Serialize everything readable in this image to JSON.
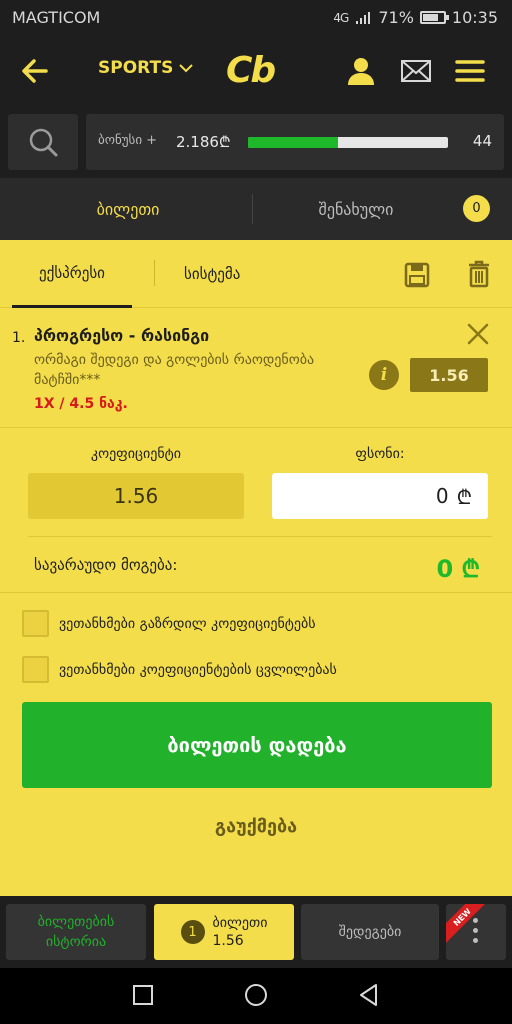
{
  "status_bar": {
    "carrier": "MAGTICOM",
    "network": "4G",
    "battery": "71%",
    "time": "10:35"
  },
  "header": {
    "back_icon": "back-arrow-icon",
    "sports_label": "SPORTS",
    "logo": "Cb",
    "icons": [
      "user-icon",
      "mail-icon",
      "menu-icon"
    ]
  },
  "bonus": {
    "label": "ბონუსი +",
    "value": "2.186₾",
    "progress_percent": 45,
    "count": "44"
  },
  "ticket_tabs": {
    "ticket": "ბილეთი",
    "saved": "შენახული",
    "saved_count": "0"
  },
  "sub_tabs": {
    "express": "ექსპრესი",
    "system": "სისტემა"
  },
  "bet": {
    "number": "1.",
    "title": "პროგრესო - რასინგი",
    "description": "ორმაგი შედეგი და გოლების რაოდენობა მატჩში***",
    "pick": "1X / 4.5 ნაკ.",
    "odd": "1.56"
  },
  "coefficient": {
    "label": "კოეფიციენტი",
    "value": "1.56"
  },
  "stake": {
    "label": "ფსონი:",
    "value": "0",
    "currency": "₾"
  },
  "potential_win": {
    "label": "სავარაუდო მოგება:",
    "value": "0 ₾"
  },
  "options": {
    "increased": "ვეთანხმები გაზრდილ კოეფიციენტებს",
    "changes": "ვეთანხმები კოეფიციენტების ცვლილებას"
  },
  "actions": {
    "place": "ბილეთის დადება",
    "cancel": "გაუქმება"
  },
  "bottom_nav": {
    "history": "ბილეთების ისტორია",
    "ticket_count": "1",
    "ticket_label": "ბილეთი",
    "ticket_odd": "1.56",
    "results": "შედეგები",
    "new_badge": "NEW"
  },
  "colors": {
    "accent": "#f3dd4a",
    "green": "#21b12b",
    "red": "#d71a1a",
    "dark": "#1e1e1e"
  }
}
